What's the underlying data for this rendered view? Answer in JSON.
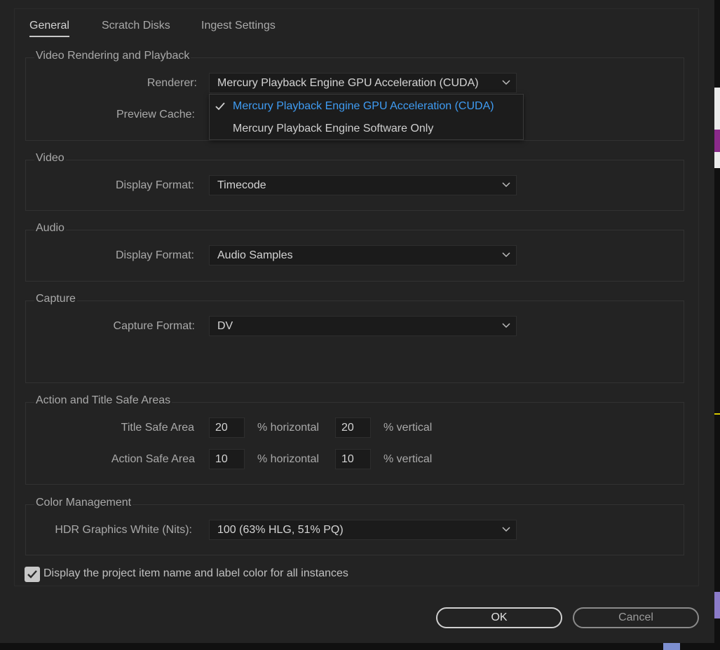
{
  "tabs": [
    {
      "label": "General",
      "active": true
    },
    {
      "label": "Scratch Disks",
      "active": false
    },
    {
      "label": "Ingest Settings",
      "active": false
    }
  ],
  "rendering": {
    "title": "Video Rendering and Playback",
    "renderer_label": "Renderer:",
    "renderer_value": "Mercury Playback Engine GPU Acceleration (CUDA)",
    "preview_cache_label": "Preview Cache:",
    "dropdown_options": [
      {
        "label": "Mercury Playback Engine GPU Acceleration (CUDA)",
        "selected": true
      },
      {
        "label": "Mercury Playback Engine Software Only",
        "selected": false
      }
    ]
  },
  "video": {
    "title": "Video",
    "display_format_label": "Display Format:",
    "display_format_value": "Timecode"
  },
  "audio": {
    "title": "Audio",
    "display_format_label": "Display Format:",
    "display_format_value": "Audio Samples"
  },
  "capture": {
    "title": "Capture",
    "format_label": "Capture Format:",
    "format_value": "DV"
  },
  "safe_areas": {
    "title": "Action and Title Safe Areas",
    "title_safe_label": "Title Safe Area",
    "title_safe_h": "20",
    "title_safe_v": "20",
    "action_safe_label": "Action Safe Area",
    "action_safe_h": "10",
    "action_safe_v": "10",
    "horizontal_unit": "% horizontal",
    "vertical_unit": "% vertical"
  },
  "color": {
    "title": "Color Management",
    "hdr_label": "HDR Graphics White (Nits):",
    "hdr_value": "100 (63% HLG, 51% PQ)"
  },
  "checkbox": {
    "label": "Display the project item name and label color for all instances",
    "checked": true
  },
  "buttons": {
    "ok": "OK",
    "cancel": "Cancel"
  },
  "colors": {
    "accent_selected": "#3f9cf3",
    "background": "#232323",
    "field": "#1b1b1b"
  }
}
